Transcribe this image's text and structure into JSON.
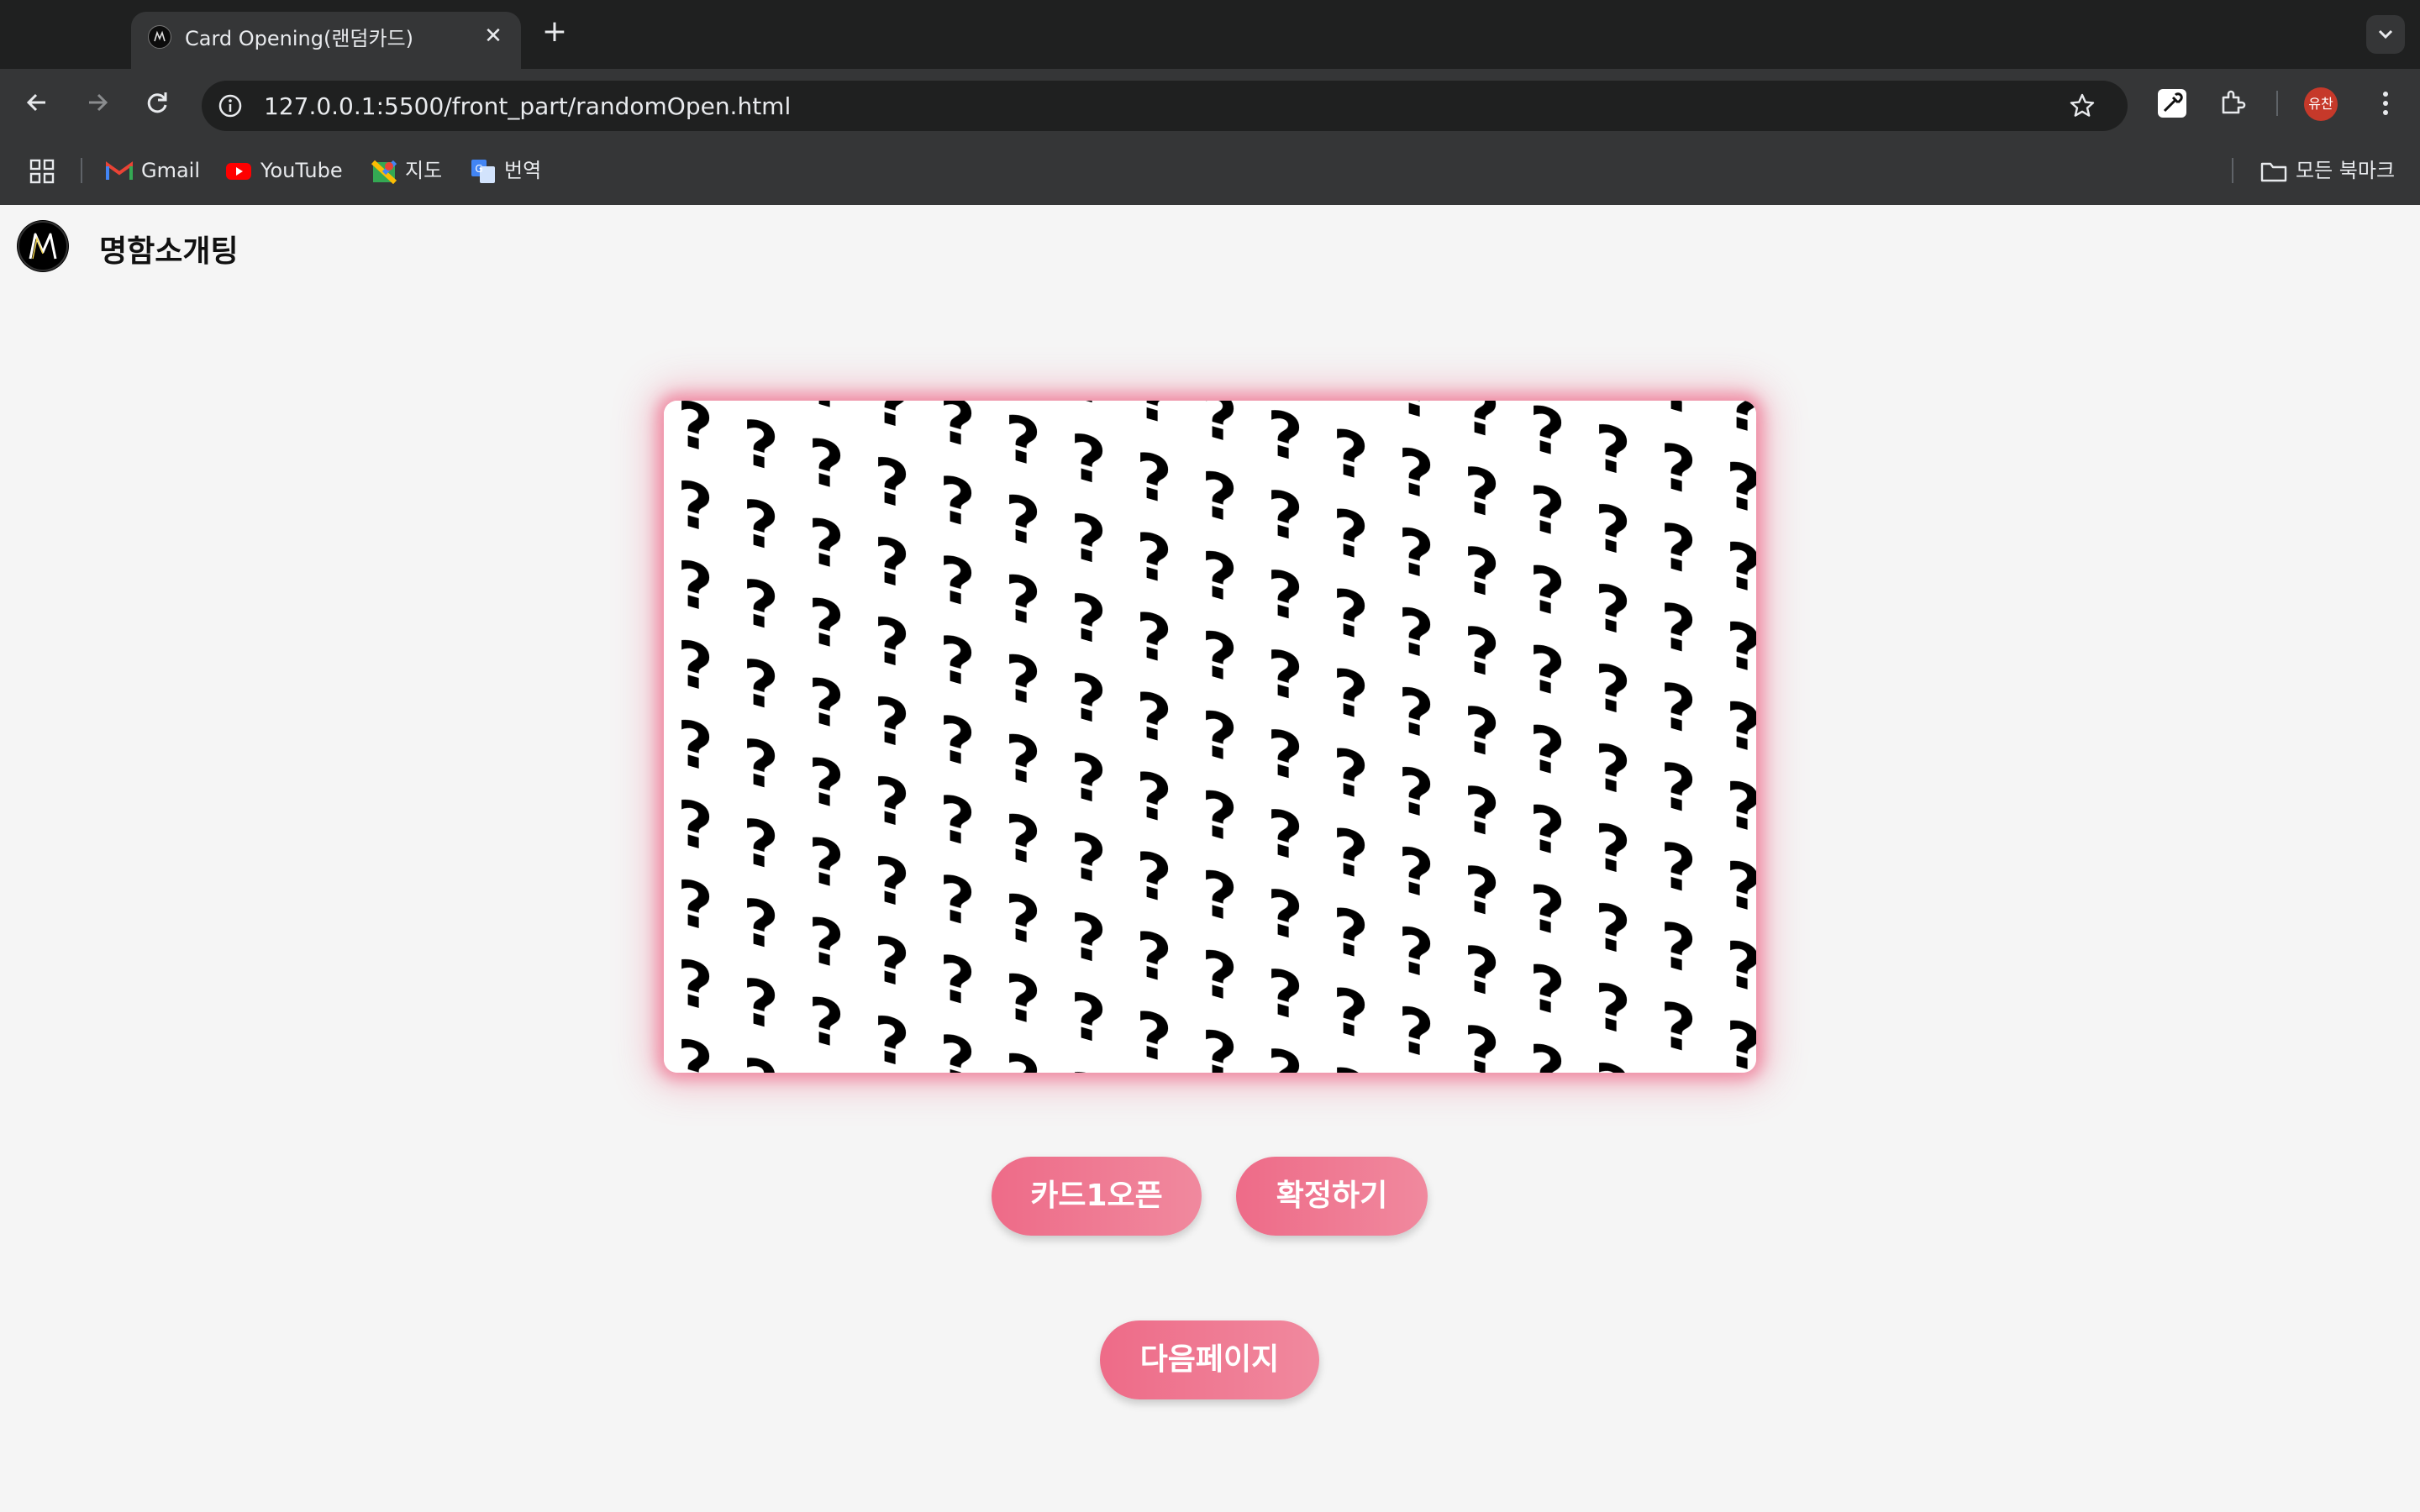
{
  "browser": {
    "tab_title": "Card Opening(랜덤카드)",
    "url": "127.0.0.1:5500/front_part/randomOpen.html",
    "profile_initials": "유찬",
    "bookmarks": [
      {
        "label": "Gmail",
        "icon": "gmail-icon"
      },
      {
        "label": "YouTube",
        "icon": "youtube-icon"
      },
      {
        "label": "지도",
        "icon": "maps-icon"
      },
      {
        "label": "번역",
        "icon": "translate-icon"
      }
    ],
    "all_bookmarks_label": "모든 북마크"
  },
  "header": {
    "site_title": "명함소개팅",
    "logo_letter": "M"
  },
  "card": {
    "pattern_glyph": "?",
    "glow_color": "#ec5478"
  },
  "buttons": {
    "open_card": "카드1오픈",
    "confirm": "확정하기",
    "next_page": "다음페이지"
  },
  "colors": {
    "button_start": "#ee6b88",
    "button_end": "#f0899e",
    "page_background": "#f5f5f5",
    "chrome_dark": "#1f2020",
    "chrome_mid": "#353637"
  }
}
